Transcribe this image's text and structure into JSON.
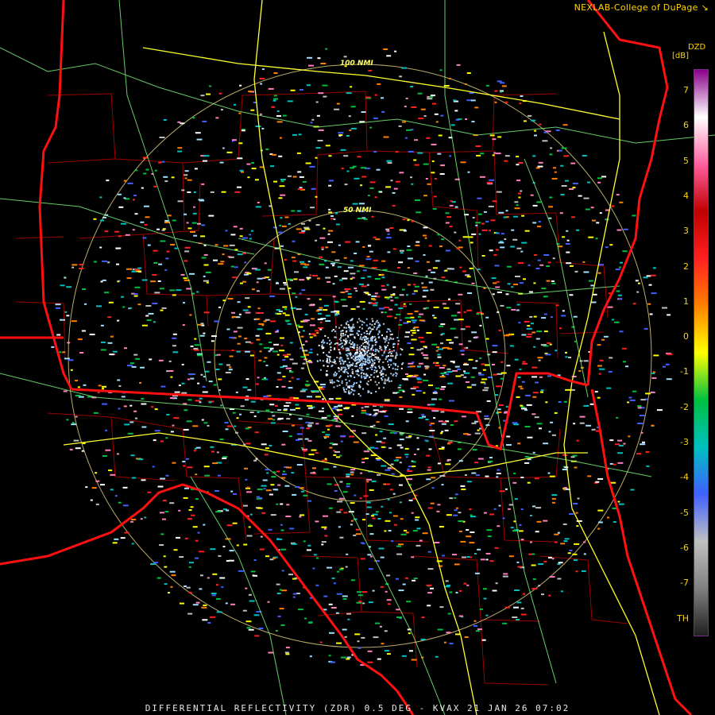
{
  "credit": "NEXLAB-College of DuPage",
  "radar": {
    "caption": "DIFFERENTIAL REFLECTIVITY (ZDR) 0.5 DEG - KVAX 21 JAN 26 07:02"
  },
  "rings": [
    {
      "label": "100 NMI"
    },
    {
      "label": "50 NMI"
    }
  ],
  "legend": {
    "title": "DZD",
    "unit": "[dB]",
    "ticks": [
      "7",
      "6",
      "5",
      "4",
      "3",
      "2",
      "1",
      "0",
      "-1",
      "-2",
      "-3",
      "-4",
      "-5",
      "-6",
      "-7",
      "TH"
    ]
  },
  "colors": {
    "background": "#000000",
    "state_border": "#ff1010",
    "county_border": "#a00000",
    "highway": "#ffff30",
    "road": "#80ff80",
    "range_ring": "#d8c878",
    "label": "#ffd400",
    "colorbar_stops": [
      "#8a008a",
      "#ffffff",
      "#ff60a0",
      "#c00000",
      "#ff2020",
      "#ff8000",
      "#ffff00",
      "#00c040",
      "#00c0c0",
      "#4060ff",
      "#c0c0c0",
      "#808080",
      "#202020"
    ]
  }
}
